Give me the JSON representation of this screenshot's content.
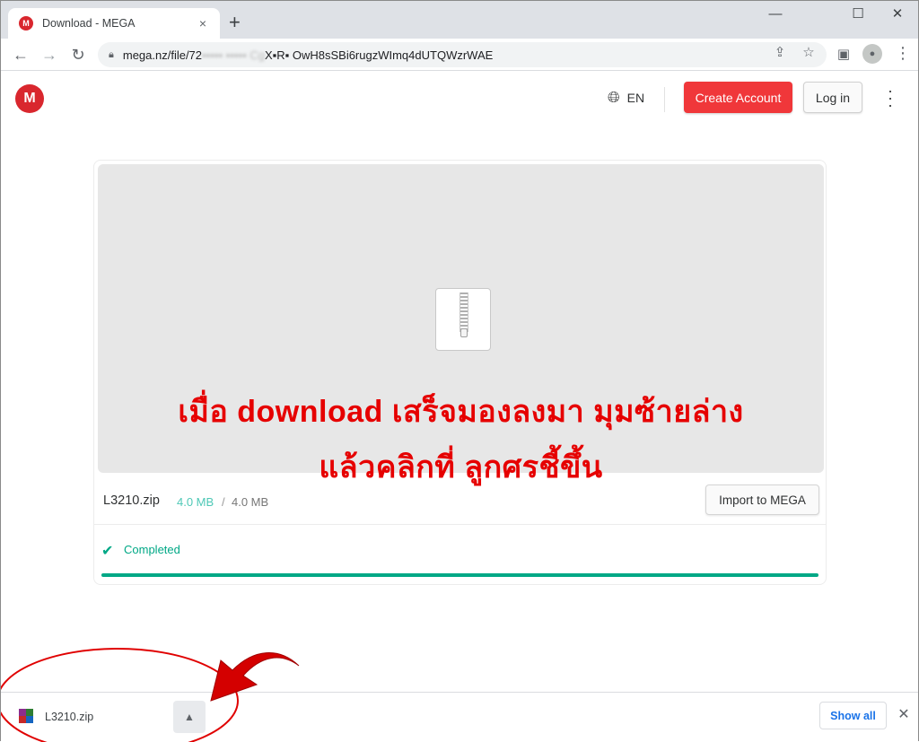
{
  "browser": {
    "tab_title": "Download - MEGA",
    "tab_favicon": "M",
    "tab_close": "×",
    "new_tab": "+",
    "minimize": "—",
    "maximize": "☐",
    "close": "✕",
    "url_visible_start": "mega.nz/file/72",
    "url_obscured": "▪▪▪▪▪ ▪▪▪▪▪ Cg",
    "url_visible_end": "X▪R▪ OwH8sSBi6rugzWImq4dUTQWzrWAE",
    "icons": {
      "back": "back-arrow-icon",
      "forward": "forward-arrow-icon",
      "reload": "reload-icon",
      "lock": "lock-icon",
      "share": "share-icon",
      "bookmark": "star-icon",
      "sidepanel": "side-panel-icon",
      "profile": "profile-icon",
      "menu": "kebab-menu-icon"
    }
  },
  "mega": {
    "logo": "M",
    "language": "EN",
    "create_account": "Create Account",
    "login": "Log in",
    "brand_color": "#d9272e",
    "accent_red": "#f0373a"
  },
  "file": {
    "name": "L3210.zip",
    "downloaded": "4.0 MB",
    "separator": "/",
    "total": "4.0 MB",
    "import_label": "Import to MEGA",
    "status": "Completed",
    "progress_fraction": 1.0,
    "status_color": "#00a886"
  },
  "overlay": {
    "line1": "เมื่อ download เสร็จมองลงมา มุมซ้ายล่าง",
    "line2": "แล้วคลิกที่ ลูกศรชี้ขึ้น",
    "color": "#e60000"
  },
  "download_shelf": {
    "filename": "L3210.zip",
    "show_all": "Show all",
    "chevron": "^",
    "close": "✕"
  }
}
